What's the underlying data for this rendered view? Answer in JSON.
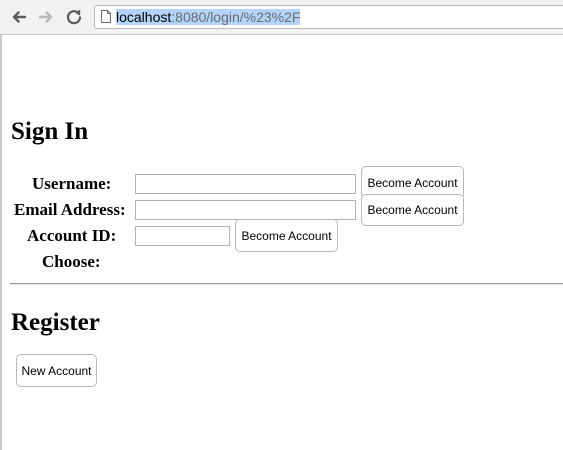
{
  "browser": {
    "url_host": "localhost",
    "url_path": ":8080/login/%23%2F",
    "back_icon": "back-arrow-icon",
    "forward_icon": "forward-arrow-icon",
    "reload_icon": "reload-icon"
  },
  "signin": {
    "title": "Sign In",
    "username_label": "Username:",
    "username_value": "",
    "email_label": "Email Address:",
    "email_value": "",
    "account_id_label": "Account ID:",
    "account_id_value": "",
    "choose_label": "Choose:",
    "become_account_label": "Become Account"
  },
  "register": {
    "title": "Register",
    "new_account_label": "New Account"
  }
}
